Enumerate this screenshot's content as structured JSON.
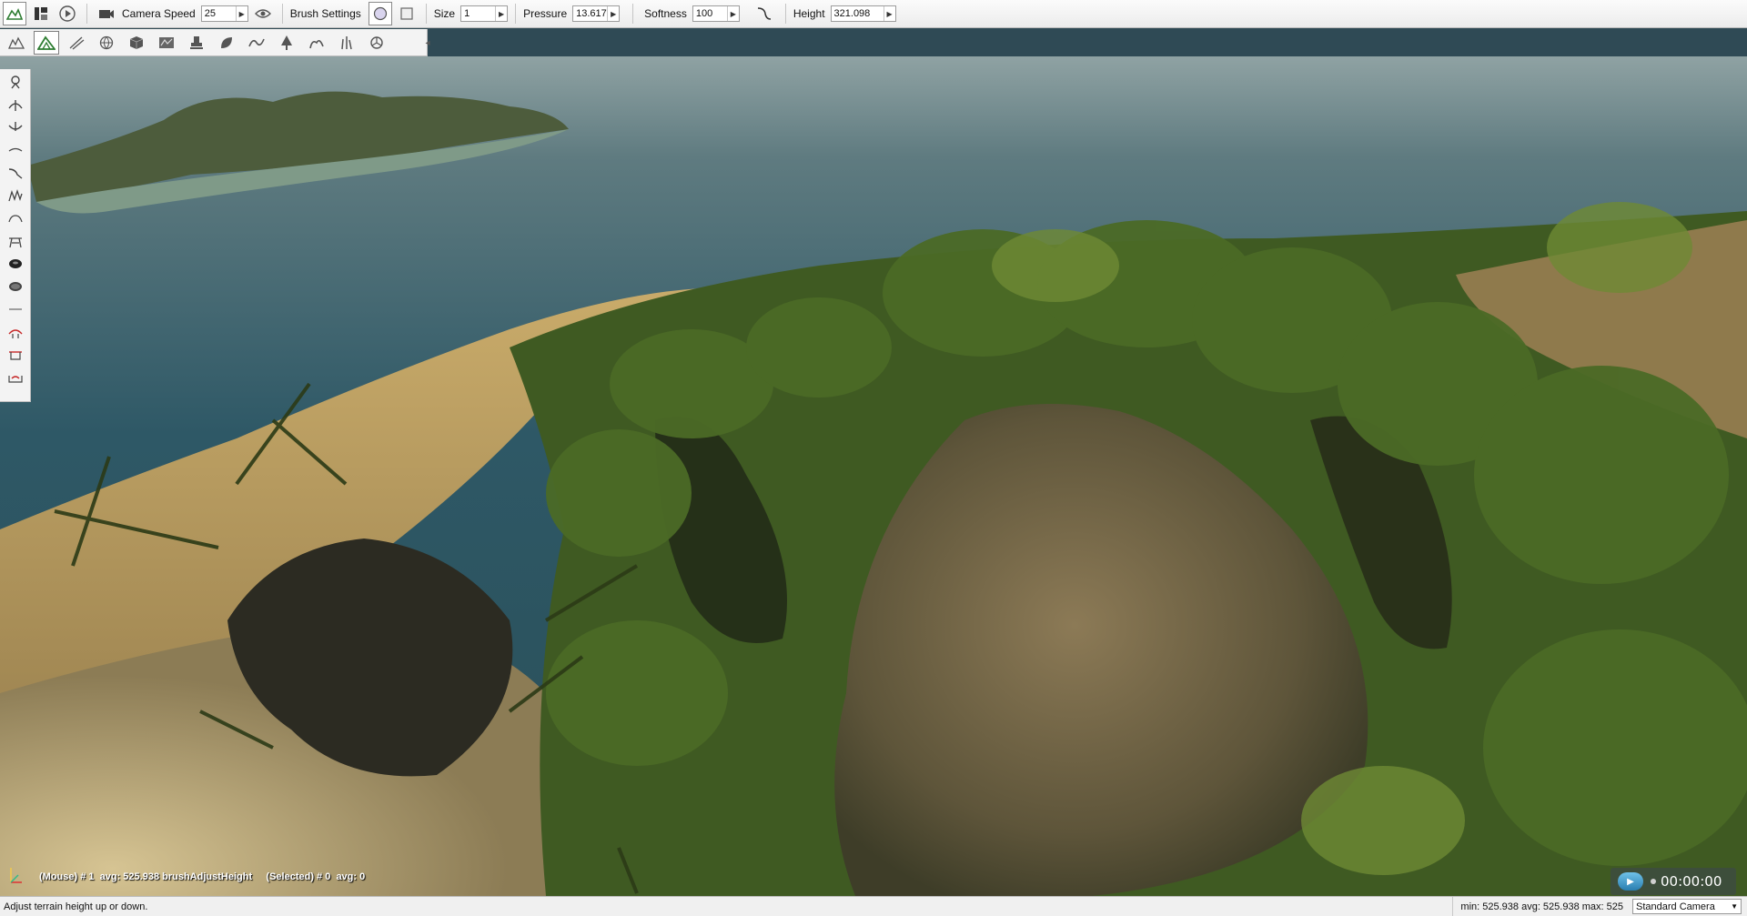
{
  "toolbar": {
    "camera_speed_label": "Camera Speed",
    "camera_speed_value": "25",
    "brush_settings_label": "Brush Settings",
    "size_label": "Size",
    "size_value": "1",
    "pressure_label": "Pressure",
    "pressure_value": "13.617",
    "softness_label": "Softness",
    "softness_value": "100",
    "height_label": "Height",
    "height_value": "321.098",
    "buttons": [
      "terrain-editor-icon",
      "panels-icon",
      "play-icon",
      "camera-icon",
      "eye-icon",
      "brush-circle-icon",
      "brush-square-icon",
      "falloff-curve-icon"
    ]
  },
  "subtoolbar": {
    "tools": [
      "terrain-tool-icon",
      "terrain-sculpt-icon",
      "road-icon",
      "globe-icon",
      "cube-icon",
      "path-icon",
      "stamp-icon",
      "leaf-icon",
      "wave-icon",
      "tree-icon",
      "bush-icon",
      "grass-icon",
      "object-icon"
    ],
    "active_index": 1
  },
  "left_tools": [
    "adjust-height-icon",
    "raise-icon",
    "lower-icon",
    "smooth-icon",
    "slope-icon",
    "noise-icon",
    "flatten-icon",
    "ramp-icon",
    "hole-icon",
    "paint-icon",
    "line-icon",
    "cliff-icon",
    "pinch-icon",
    "erode-icon"
  ],
  "viewport": {
    "hud_mouse": "(Mouse) # 1  avg: 525.938 brushAdjustHeight",
    "hud_selected": "(Selected) # 0  avg: 0",
    "time": "00:00:00"
  },
  "status": {
    "hint": "Adjust terrain height up or down.",
    "stats": "min: 525.938   avg: 525.938   max: 525",
    "camera": "Standard Camera"
  },
  "colors": {
    "accent": "#2a7eb0",
    "toolbar_bg": "#ececec",
    "water": "#2f5663",
    "sand": "#b39656",
    "forest": "#3f5a22"
  }
}
